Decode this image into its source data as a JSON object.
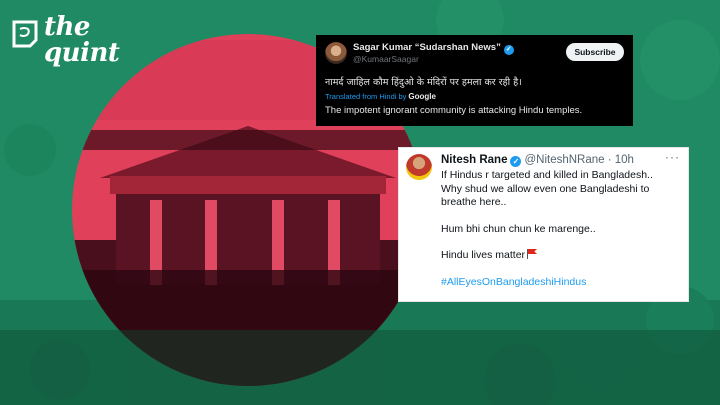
{
  "brand": {
    "logo_line1": "the",
    "logo_line2": "quint"
  },
  "colors": {
    "flag_green": "#1f8a63",
    "flag_red": "#e0405a",
    "twitter_blue": "#1d9bf0"
  },
  "tweets": [
    {
      "theme": "dark",
      "author_name": "Sagar Kumar “Sudarshan News”",
      "handle": "@KumaarSaagar",
      "verified": true,
      "subscribe_label": "Subscribe",
      "text_original": "नामर्द जाहिल कौम हिंदुओ के मंदिरों पर हमला कर रही है।",
      "translated_label": "Translated from Hindi by",
      "translator": "Google",
      "text_translated": "The impotent ignorant community is attacking Hindu temples."
    },
    {
      "theme": "light",
      "author_name": "Nitesh Rane",
      "handle_time": "@NiteshNRane · 10h",
      "verified": true,
      "more_icon": "···",
      "lines": [
        "If Hindus r targeted and killed in Bangladesh..",
        "Why shud we allow even one Bangladeshi to",
        "breathe here..",
        "Hum bhi chun chun ke marenge..",
        "Hindu lives matter"
      ],
      "hashtag": "#AllEyesOnBangladeshiHindus"
    }
  ]
}
